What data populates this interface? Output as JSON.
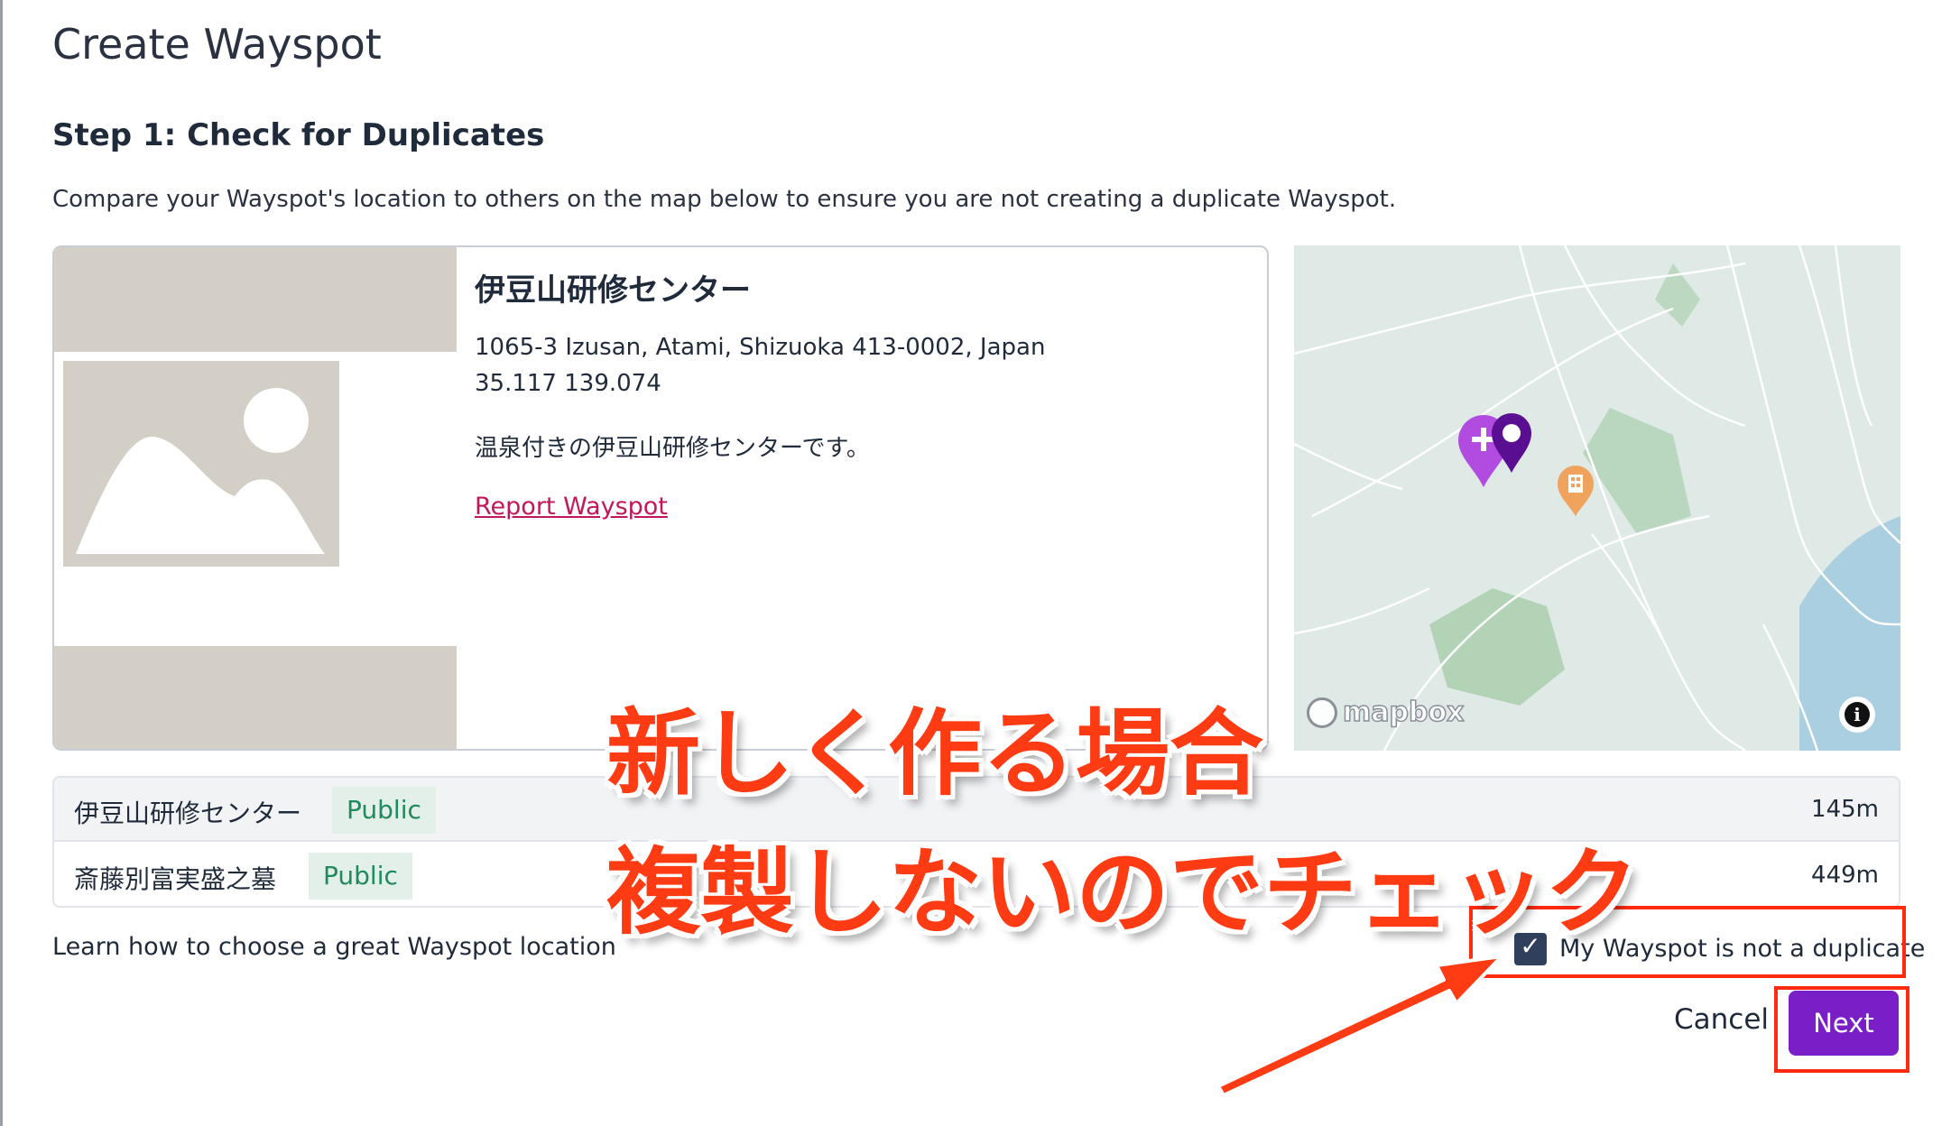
{
  "page": {
    "title": "Create Wayspot",
    "step_title": "Step 1: Check for Duplicates",
    "description": "Compare your Wayspot's location to others on the map below to ensure you are not creating a duplicate Wayspot."
  },
  "wayspot": {
    "name": "伊豆山研修センター",
    "address": "1065-3 Izusan, Atami, Shizuoka 413-0002, Japan",
    "coords": "35.117 139.074",
    "description": "温泉付きの伊豆山研修センターです。",
    "report_label": "Report Wayspot",
    "thumbnail_icon": "image-placeholder-icon"
  },
  "map": {
    "attribution": "mapbox",
    "info_label": "i",
    "pins": [
      "new-wayspot-pin-icon",
      "existing-wayspot-pin-icon",
      "building-pin-icon"
    ]
  },
  "nearby": [
    {
      "name": "伊豆山研修センター",
      "status": "Public",
      "distance": "145m"
    },
    {
      "name": "斎藤別富実盛之墓",
      "status": "Public",
      "distance": "449m"
    }
  ],
  "footer": {
    "learn_link": "Learn how to choose a great Wayspot location",
    "checkbox_label": "My Wayspot is not a duplicate",
    "checkbox_checked": true,
    "checkmark": "✓",
    "cancel_label": "Cancel",
    "next_label": "Next"
  },
  "annotations": {
    "line1": "新しく作る場合",
    "line2": "複製しないのでチェック"
  },
  "colors": {
    "accent": "#7a1fc7",
    "link": "#c2185b",
    "badge_text": "#1f8a5b",
    "annotation": "#ff3b14"
  }
}
